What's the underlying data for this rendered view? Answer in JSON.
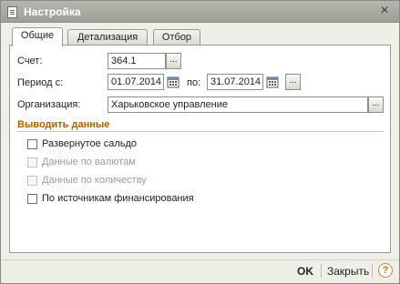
{
  "window": {
    "title": "Настройка",
    "close_glyph": "×"
  },
  "tabs": [
    {
      "label": "Общие",
      "active": true
    },
    {
      "label": "Детализация",
      "active": false
    },
    {
      "label": "Отбор",
      "active": false
    }
  ],
  "form": {
    "account": {
      "label": "Счет:",
      "value": "364.1",
      "select_glyph": "..."
    },
    "period": {
      "label": "Период с:",
      "from": "01.07.2014",
      "to_label": "по:",
      "to": "31.07.2014",
      "select_glyph": "..."
    },
    "organization": {
      "label": "Организация:",
      "value": "Харьковское управление",
      "select_glyph": "..."
    }
  },
  "output_section": {
    "header": "Выводить данные",
    "options": [
      {
        "label": "Развернутое сальдо",
        "checked": false,
        "enabled": true
      },
      {
        "label": "Данные по валютам",
        "checked": false,
        "enabled": false
      },
      {
        "label": "Данные по количеству",
        "checked": false,
        "enabled": false
      },
      {
        "label": "По источникам финансирования",
        "checked": false,
        "enabled": true
      }
    ]
  },
  "footer": {
    "ok_label": "OK",
    "close_label": "Закрыть",
    "help_glyph": "?"
  },
  "colors": {
    "section_header": "#b45f00",
    "help_accent": "#d28a2a"
  },
  "icons": {
    "window": "document-icon",
    "calendar": "calendar-icon",
    "close": "close-icon",
    "help": "help-icon"
  }
}
